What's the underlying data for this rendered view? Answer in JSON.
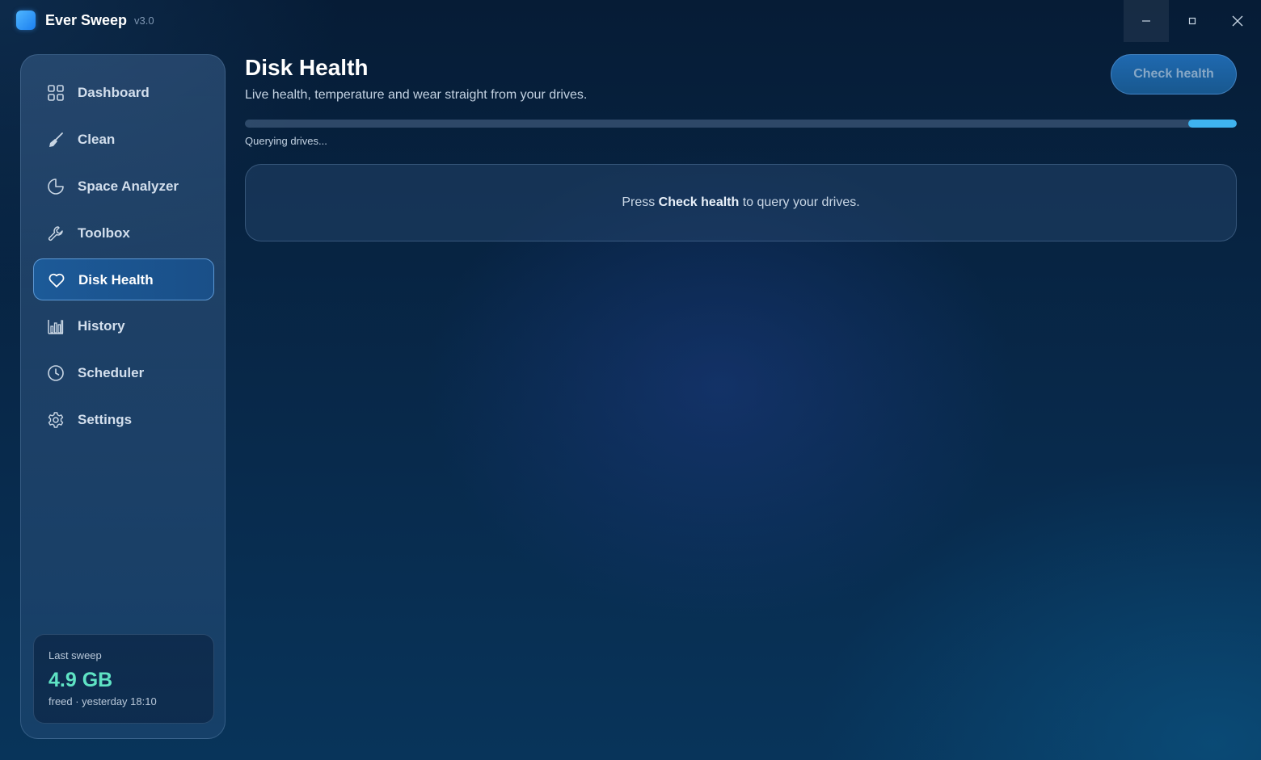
{
  "app": {
    "name": "Ever Sweep",
    "version": "v3.0",
    "logo_icon": "app-logo-square",
    "accent_color": "#3fb3ef"
  },
  "window_controls": {
    "minimize_icon": "minimize-icon",
    "maximize_icon": "maximize-icon",
    "close_icon": "close-icon"
  },
  "sidebar": {
    "items": [
      {
        "label": "Dashboard",
        "icon": "grid-icon",
        "active": false
      },
      {
        "label": "Clean",
        "icon": "broom-icon",
        "active": false
      },
      {
        "label": "Space Analyzer",
        "icon": "pie-chart-icon",
        "active": false
      },
      {
        "label": "Toolbox",
        "icon": "wrench-icon",
        "active": false
      },
      {
        "label": "Disk Health",
        "icon": "heart-icon",
        "active": true
      },
      {
        "label": "History",
        "icon": "bar-chart-icon",
        "active": false
      },
      {
        "label": "Scheduler",
        "icon": "clock-icon",
        "active": false
      },
      {
        "label": "Settings",
        "icon": "gear-icon",
        "active": false
      }
    ],
    "last_sweep": {
      "label": "Last sweep",
      "value": "4.9 GB",
      "sub": "freed · yesterday 18:10",
      "value_color": "#5fe3c4"
    }
  },
  "main": {
    "title": "Disk Health",
    "subtitle": "Live health, temperature and wear straight from your drives.",
    "action_label": "Check health",
    "progress": {
      "status": "Querying drives...",
      "state": "indeterminate"
    },
    "empty_state": {
      "prefix": "Press ",
      "emphasis": "Check health",
      "suffix": " to query your drives."
    }
  }
}
